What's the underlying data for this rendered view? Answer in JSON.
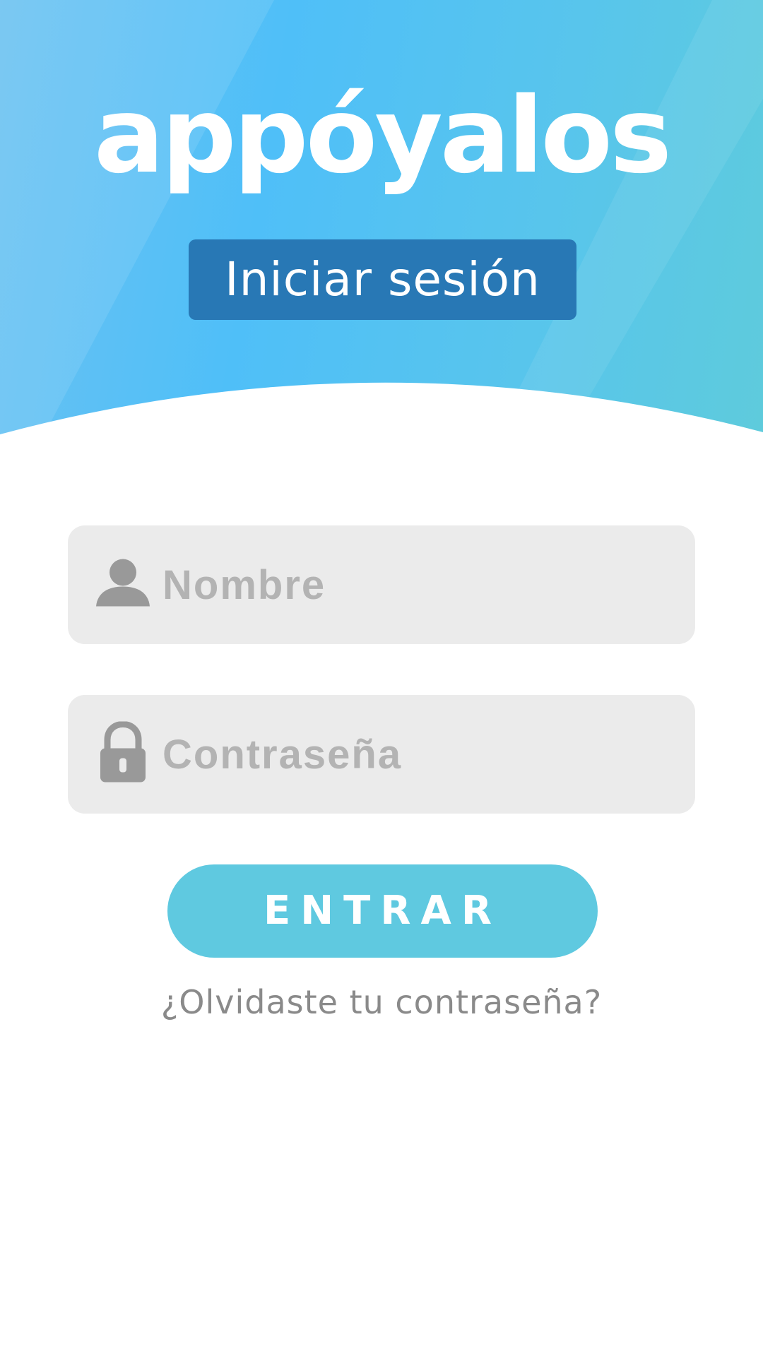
{
  "app": {
    "logo_text": "appóyalos"
  },
  "header": {
    "title": "Iniciar sesión"
  },
  "form": {
    "username": {
      "placeholder": "Nombre",
      "value": "",
      "icon": "user-icon"
    },
    "password": {
      "placeholder": "Contraseña",
      "value": "",
      "icon": "lock-icon"
    },
    "submit_label": "ENTRAR",
    "forgot_label": "¿Olvidaste tu contraseña?"
  },
  "colors": {
    "header_gradient_start": "#6cc2f1",
    "header_gradient_end": "#5ecbdc",
    "title_badge": "#2878b5",
    "button": "#5fc9e0",
    "field_background": "#ebebeb",
    "placeholder_text": "#b3b3b3",
    "icon_gray": "#999999",
    "link_text": "#8a8a8a"
  }
}
